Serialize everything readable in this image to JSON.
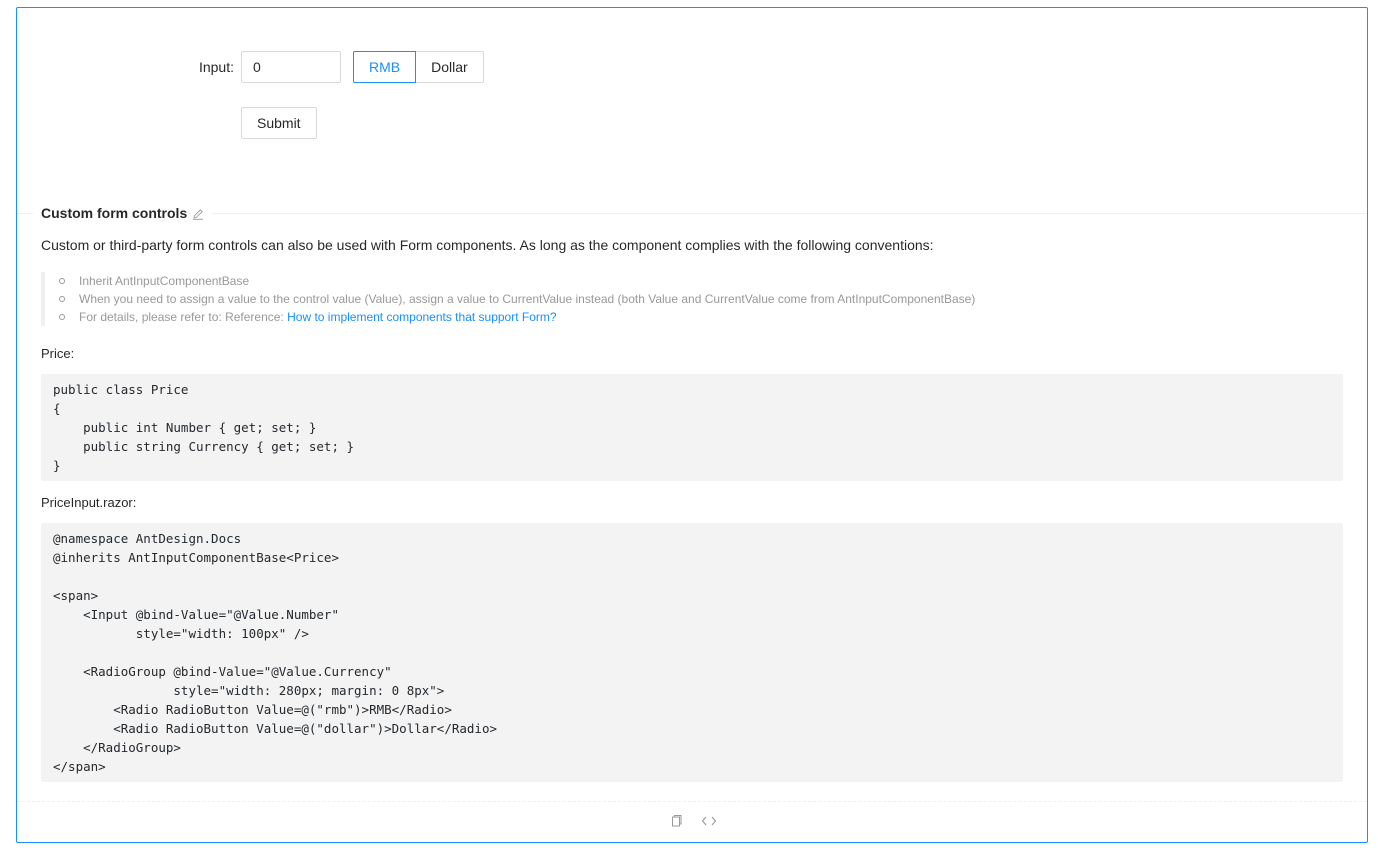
{
  "form": {
    "input_label": "Input:",
    "input_value": "0",
    "currency_options": [
      "RMB",
      "Dollar"
    ],
    "selected_currency": "RMB",
    "submit_label": "Submit"
  },
  "docs": {
    "title": "Custom form controls",
    "description": "Custom or third-party form controls can also be used with Form components. As long as the component complies with the following conventions:",
    "conventions": [
      "Inherit AntInputComponentBase",
      "When you need to assign a value to the control value (Value), assign a value to CurrentValue instead (both Value and CurrentValue come from AntInputComponentBase)"
    ],
    "reference_prefix": "For details, please refer to: Reference: ",
    "reference_link": "How to implement components that support Form?",
    "price_label": "Price:",
    "price_code": "public class Price\n{\n    public int Number { get; set; }\n    public string Currency { get; set; }\n}",
    "priceinput_label": "PriceInput.razor:",
    "priceinput_code": "@namespace AntDesign.Docs\n@inherits AntInputComponentBase<Price>\n\n<span>\n    <Input @bind-Value=\"@Value.Number\"\n           style=\"width: 100px\" />\n\n    <RadioGroup @bind-Value=\"@Value.Currency\"\n                style=\"width: 280px; margin: 0 8px\">\n        <Radio RadioButton Value=@(\"rmb\")>RMB</Radio>\n        <Radio RadioButton Value=@(\"dollar\")>Dollar</Radio>\n    </RadioGroup>\n</span>"
  },
  "icons": {
    "edit": "edit-icon",
    "copy": "copy-icon",
    "code": "code-icon"
  },
  "colors": {
    "primary": "#1890ff",
    "border": "#d9d9d9",
    "muted": "#999999",
    "code_bg": "#f3f3f3"
  }
}
